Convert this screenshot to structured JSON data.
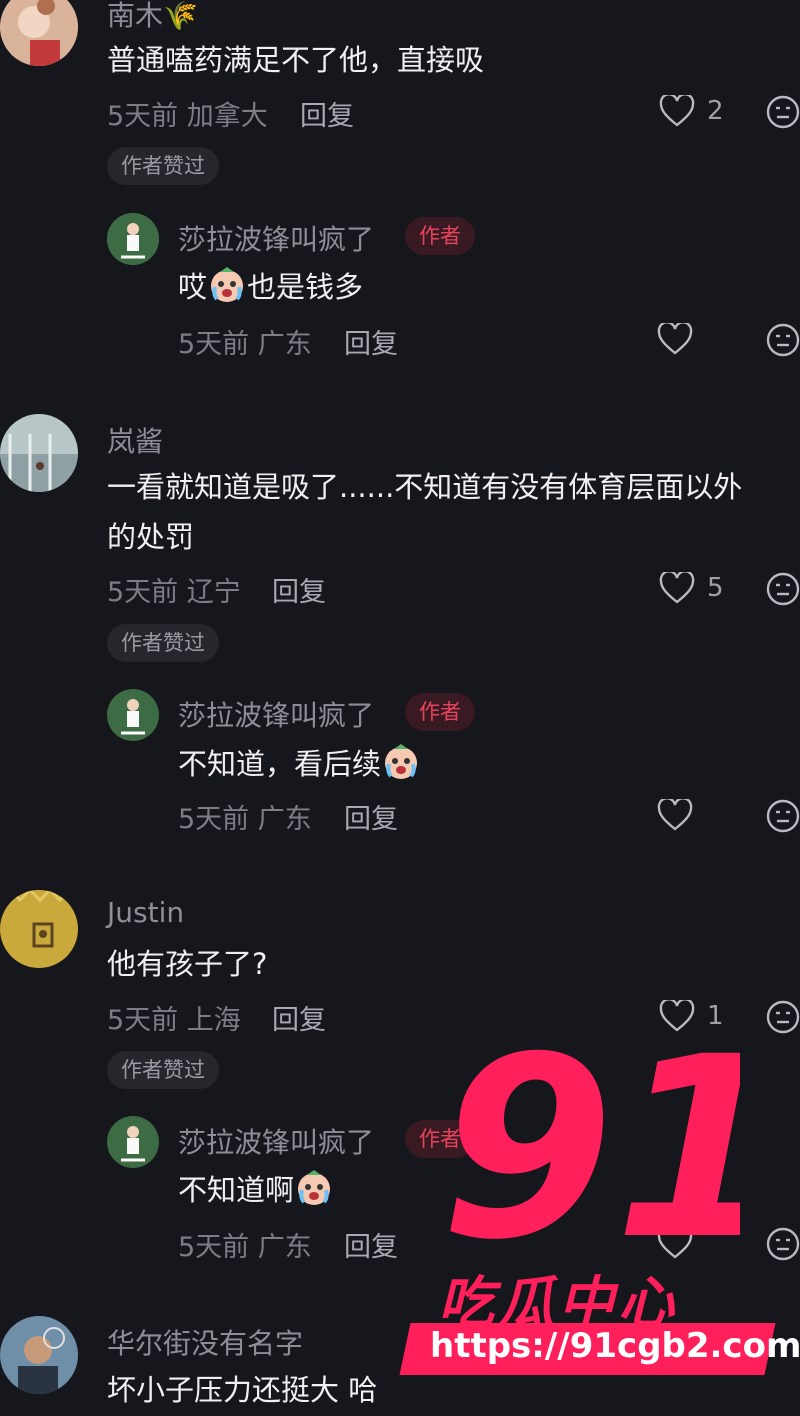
{
  "comments": [
    {
      "user": "南木",
      "user_suffix_icon": "rice-ear-emoji",
      "text": "普通嗑药满足不了他，直接吸",
      "time": "5天前",
      "location": "加拿大",
      "reply_label": "回复",
      "likes": "2",
      "author_liked": "作者赞过",
      "author_reply": {
        "user": "莎拉波锋叫疯了",
        "tag": "作者",
        "text_before": "哎",
        "emoji": "crying-face-emoji",
        "text_after": "也是钱多",
        "time": "5天前",
        "location": "广东",
        "reply_label": "回复"
      }
    },
    {
      "user": "岚酱",
      "text_line1": "一看就知道是吸了......不知道有没有体育层面以外",
      "text_line2": "的处罚",
      "time": "5天前",
      "location": "辽宁",
      "reply_label": "回复",
      "likes": "5",
      "author_liked": "作者赞过",
      "author_reply": {
        "user": "莎拉波锋叫疯了",
        "tag": "作者",
        "text_before": "不知道，看后续",
        "emoji": "crying-face-emoji",
        "time": "5天前",
        "location": "广东",
        "reply_label": "回复"
      }
    },
    {
      "user": "Justin",
      "text": "他有孩子了?",
      "time": "5天前",
      "location": "上海",
      "reply_label": "回复",
      "likes": "1",
      "author_liked": "作者赞过",
      "author_reply": {
        "user": "莎拉波锋叫疯了",
        "tag": "作者",
        "text_before": "不知道啊",
        "emoji": "crying-face-emoji",
        "time": "5天前",
        "location": "广东",
        "reply_label": "回复"
      }
    },
    {
      "user": "华尔街没有名字",
      "text": "坏小子压力还挺大 哈"
    }
  ],
  "watermark": {
    "number": "91",
    "subtitle": "吃瓜中心",
    "url": "https://91cgb2.com"
  },
  "colors": {
    "background": "#16161d",
    "author_tag": "#e8435d",
    "watermark": "#ff1f5b"
  }
}
